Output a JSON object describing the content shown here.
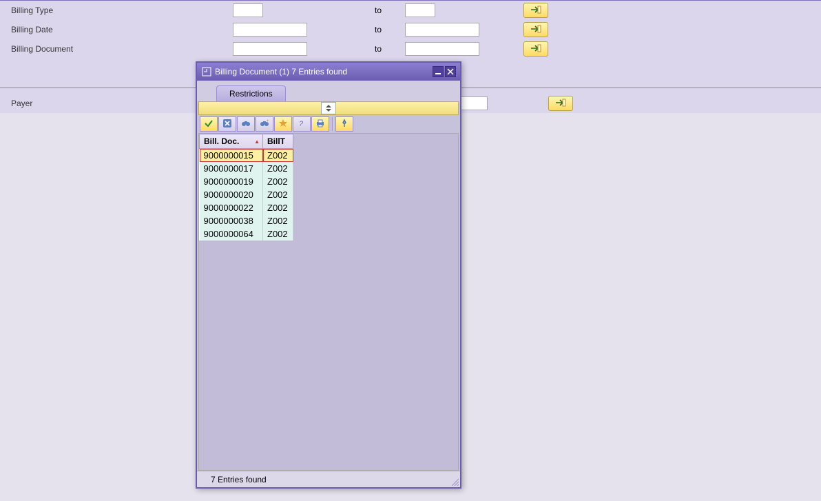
{
  "selection": {
    "billing_type": {
      "label": "Billing Type",
      "from": "",
      "to_label": "to",
      "to": ""
    },
    "billing_date": {
      "label": "Billing Date",
      "from": "",
      "to_label": "to",
      "to": ""
    },
    "billing_document": {
      "label": "Billing Document",
      "from": "",
      "to_label": "to",
      "to": ""
    },
    "payer": {
      "label": "Payer",
      "from": "",
      "to": ""
    }
  },
  "dialog": {
    "title": "Billing Document (1)   7 Entries found",
    "tab": "Restrictions",
    "columns": {
      "bill_doc": "Bill. Doc.",
      "bill_type": "BillT"
    },
    "rows": [
      {
        "bill_doc": "9000000015",
        "bill_type": "Z002",
        "selected": true
      },
      {
        "bill_doc": "9000000017",
        "bill_type": "Z002",
        "selected": false
      },
      {
        "bill_doc": "9000000019",
        "bill_type": "Z002",
        "selected": false
      },
      {
        "bill_doc": "9000000020",
        "bill_type": "Z002",
        "selected": false
      },
      {
        "bill_doc": "9000000022",
        "bill_type": "Z002",
        "selected": false
      },
      {
        "bill_doc": "9000000038",
        "bill_type": "Z002",
        "selected": false
      },
      {
        "bill_doc": "9000000064",
        "bill_type": "Z002",
        "selected": false
      }
    ],
    "status": "7 Entries found"
  }
}
